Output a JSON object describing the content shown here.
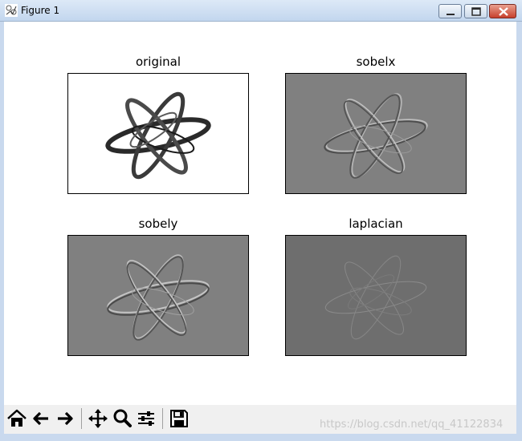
{
  "window": {
    "title": "Figure 1",
    "icon": "matplotlib-figure-icon"
  },
  "title_buttons": [
    "minimize-icon",
    "maximize-icon",
    "close-icon"
  ],
  "subplots": [
    {
      "title": "original",
      "background": "#ffffff",
      "style": "dark-strokes"
    },
    {
      "title": "sobelx",
      "background": "#808080",
      "style": "embossed"
    },
    {
      "title": "sobely",
      "background": "#808080",
      "style": "embossed"
    },
    {
      "title": "laplacian",
      "background": "#6e6e6e",
      "style": "faint-edges"
    }
  ],
  "toolbar": {
    "buttons": [
      {
        "name": "home-button",
        "icon": "home-icon"
      },
      {
        "name": "back-button",
        "icon": "arrow-left-icon"
      },
      {
        "name": "forward-button",
        "icon": "arrow-right-icon"
      },
      {
        "name": "pan-button",
        "icon": "move-icon"
      },
      {
        "name": "zoom-button",
        "icon": "magnifier-icon"
      },
      {
        "name": "configure-subplots-button",
        "icon": "sliders-icon"
      },
      {
        "name": "save-button",
        "icon": "floppy-disk-icon"
      }
    ],
    "watermark": "https://blog.csdn.net/qq_41122834"
  }
}
